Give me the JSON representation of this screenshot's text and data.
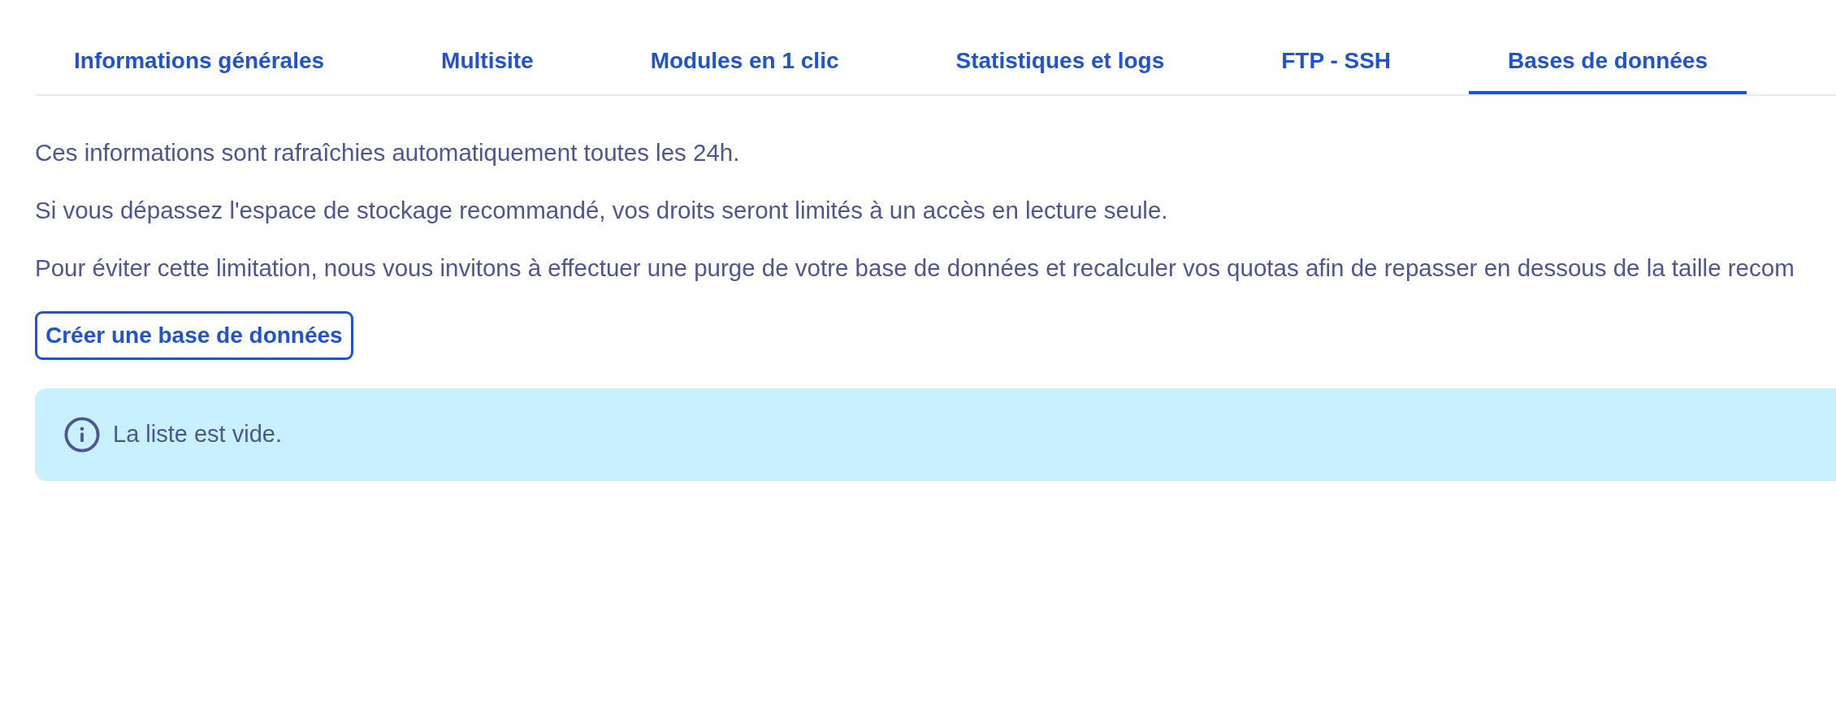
{
  "tabs": [
    {
      "label": "Informations générales",
      "selected": false
    },
    {
      "label": "Multisite",
      "selected": false
    },
    {
      "label": "Modules en 1 clic",
      "selected": false
    },
    {
      "label": "Statistiques et logs",
      "selected": false
    },
    {
      "label": "FTP - SSH",
      "selected": false
    },
    {
      "label": "Bases de données",
      "selected": true
    }
  ],
  "paragraphs": [
    "Ces informations sont rafraîchies automatiquement toutes les 24h.",
    "Si vous dépassez l'espace de stockage recommandé, vos droits seront limités à un accès en lecture seule.",
    "Pour éviter cette limitation, nous vous invitons à effectuer une purge de votre base de données et recalculer vos quotas afin de repasser en dessous de la taille recom"
  ],
  "create_button": {
    "label": "Créer une base de données"
  },
  "alert": {
    "kind": "info",
    "message": "La liste est vide."
  }
}
